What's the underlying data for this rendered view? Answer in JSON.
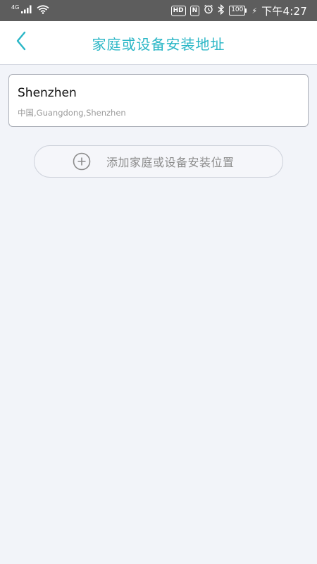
{
  "status_bar": {
    "network_label": "4G",
    "icons": [
      "signal-icon",
      "wifi-icon",
      "hd-icon",
      "nfc-icon",
      "alarm-icon",
      "bluetooth-icon",
      "battery-icon",
      "charging-icon"
    ],
    "hd_label": "HD",
    "nfc_label": "N",
    "battery_level": "100",
    "time": "下午4:27"
  },
  "header": {
    "back_icon": "chevron-left-icon",
    "title": "家庭或设备安装地址",
    "accent_color": "#29b6c6"
  },
  "addresses": [
    {
      "name": "Shenzhen",
      "detail": "中国,Guangdong,Shenzhen"
    }
  ],
  "add_button": {
    "icon": "plus-circle-icon",
    "label": "添加家庭或设备安装位置"
  }
}
